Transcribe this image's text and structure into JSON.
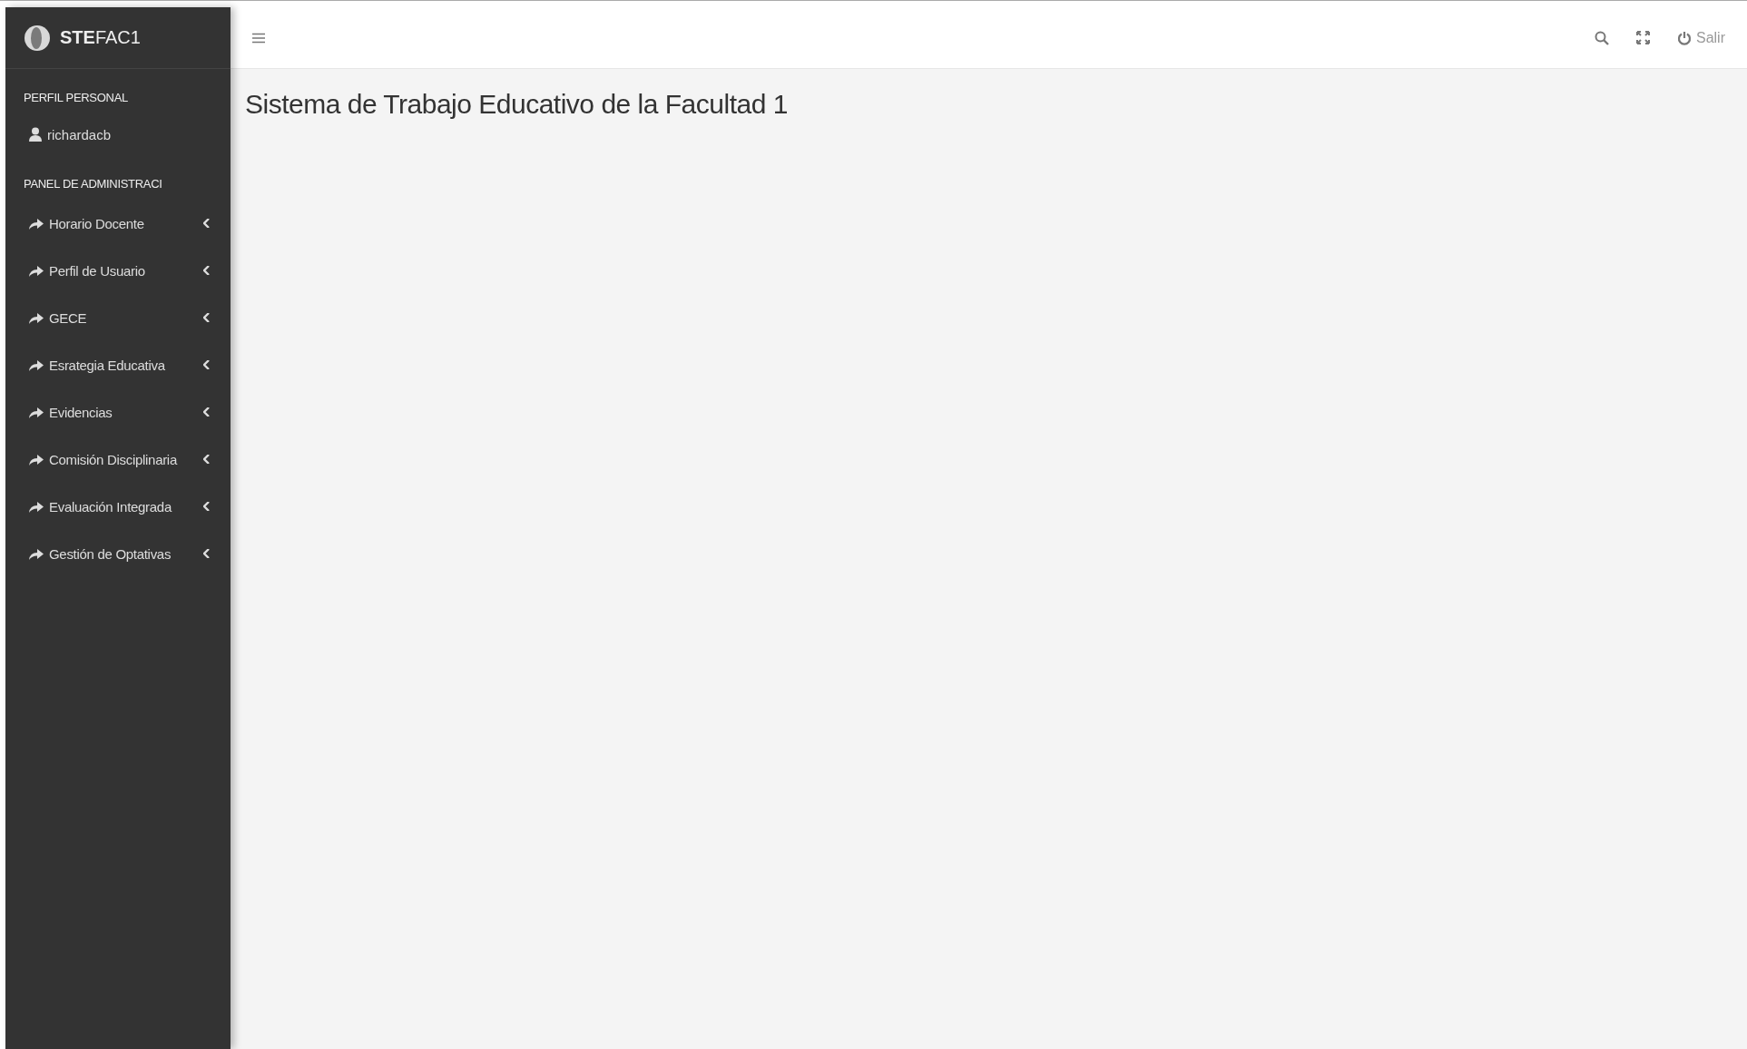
{
  "sidebar": {
    "brand": "**STE**FAC1",
    "sections": [
      {
        "heading": "PERFIL PERSONAL",
        "items": [
          {
            "kind": "user",
            "label": "richardacb"
          }
        ]
      },
      {
        "heading": "PANEL DE ADMINISTRACI",
        "items": [
          {
            "kind": "menu",
            "label": "Horario Docente",
            "expanded": false
          },
          {
            "kind": "menu",
            "label": "Perfil de Usuario",
            "expanded": false
          },
          {
            "kind": "menu",
            "label": "GECE",
            "expanded": false
          },
          {
            "kind": "menu",
            "label": "Esrategia Educativa",
            "expanded": false
          },
          {
            "kind": "menu",
            "label": "Evidencias",
            "expanded": false
          },
          {
            "kind": "menu",
            "label": "Comisión Disciplinaria",
            "expanded": false
          },
          {
            "kind": "menu",
            "label": "Evaluación Integrada",
            "expanded": false
          },
          {
            "kind": "menu",
            "label": "Gestión de Optativas",
            "expanded": false
          }
        ]
      }
    ]
  },
  "header": {
    "logout": "Salir"
  },
  "page": {
    "title": "Sistema de Trabajo Educativo de la Facultad 1"
  }
}
